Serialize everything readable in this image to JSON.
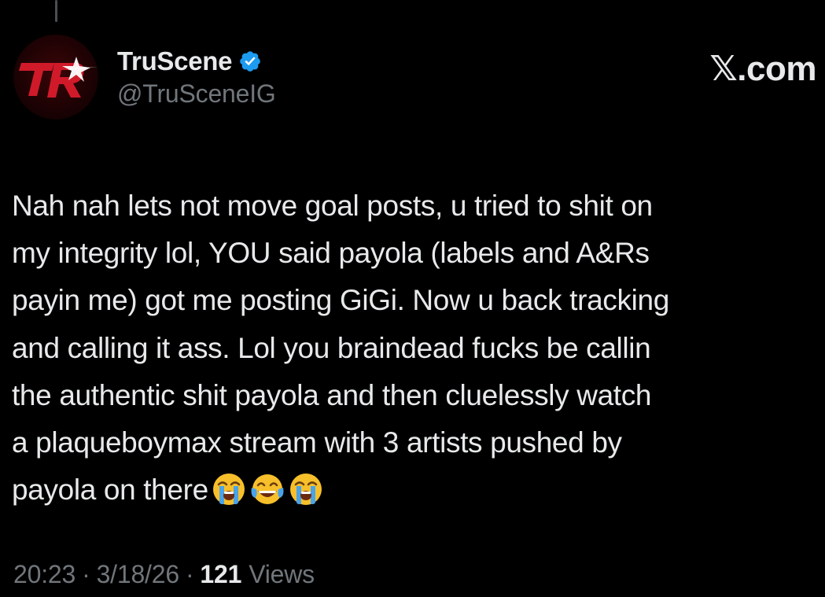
{
  "author": {
    "display_name": "TruScene",
    "handle": "@TruSceneIG",
    "verified": true,
    "avatar_initials": "TR"
  },
  "site_label": "𝕏.com",
  "tweet": {
    "text": "Nah nah lets not move goal posts, u tried to shit on\nmy integrity lol, YOU said payola (labels and A&Rs\npayin me) got me posting GiGi. Now u back tracking\nand calling it ass. Lol you braindead fucks be callin\nthe authentic shit payola and then cluelessly watch\na plaqueboymax stream with 3 artists pushed by\npayola on there",
    "emojis": [
      "loudly-crying-face",
      "face-with-tears-of-joy",
      "loudly-crying-face"
    ]
  },
  "meta": {
    "time": "20:23",
    "separator": "·",
    "date": "3/18/26",
    "views_count": "121",
    "views_label": "Views"
  },
  "colors": {
    "background": "#000000",
    "text_primary": "#e7e9ea",
    "text_secondary": "#71767b",
    "verified_blue": "#1d9bf0",
    "avatar_red": "#c8102e"
  }
}
